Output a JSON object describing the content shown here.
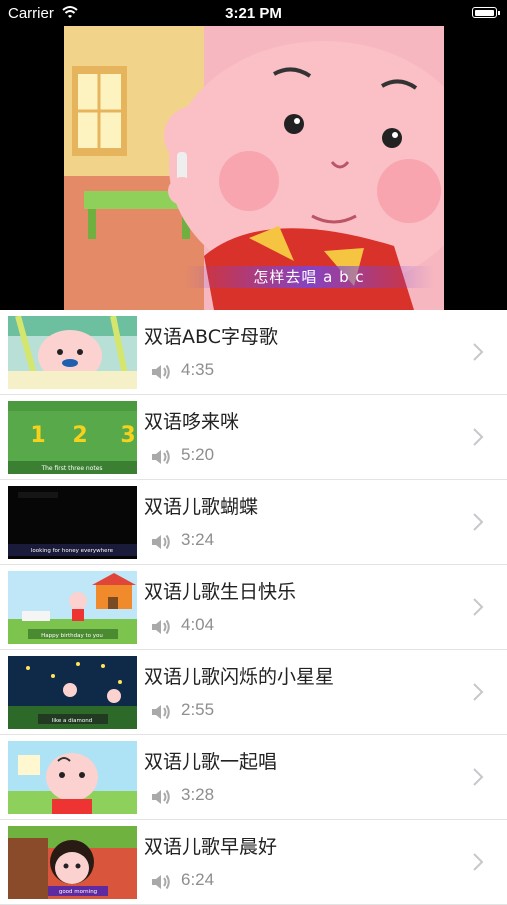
{
  "status_bar": {
    "carrier": "Carrier",
    "time": "3:21 PM",
    "battery_level": 0.95
  },
  "player": {
    "subtitle": "怎样去唱 a b c"
  },
  "videos": [
    {
      "title": "双语ABC字母歌",
      "duration": "4:35"
    },
    {
      "title": "双语哆来咪",
      "duration": "5:20"
    },
    {
      "title": "双语儿歌蝴蝶",
      "duration": "3:24"
    },
    {
      "title": "双语儿歌生日快乐",
      "duration": "4:04"
    },
    {
      "title": "双语儿歌闪烁的小星星",
      "duration": "2:55"
    },
    {
      "title": "双语儿歌一起唱",
      "duration": "3:28"
    },
    {
      "title": "双语儿歌早晨好",
      "duration": "6:24"
    }
  ],
  "thumb_captions": [
    "",
    "The first three notes",
    "looking for honey everywhere",
    "Happy birthday to you",
    "like a diamond",
    "",
    "good morning"
  ],
  "thumb_numbers": [
    "1",
    "2",
    "3"
  ],
  "icons": {
    "speaker": "speaker-icon",
    "chevron": "chevron-right-icon",
    "wifi": "wifi-icon",
    "battery": "battery-icon"
  }
}
